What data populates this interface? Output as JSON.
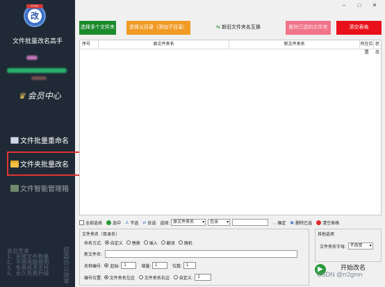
{
  "sidebar": {
    "logo_text": "改",
    "logo_tag": "FTPN",
    "app_title": "文件批量改名高手",
    "member_center": "会员中心",
    "nav": [
      {
        "label": "文件批量重命名"
      },
      {
        "label": "文件夹批量改名"
      },
      {
        "label": "文件智能管理箱"
      }
    ],
    "promo_lines": [
      "会员专享",
      "1、无限文件数量",
      "2、不限电脑使用",
      "3、免费技术支持",
      "4、永久免费升级"
    ],
    "vertical_text": "提高办公效率"
  },
  "window": {
    "minimize": "–",
    "maximize": "□",
    "close": "✕"
  },
  "toolbar": {
    "multi_folder": "选择多个文件夹",
    "parent_dir": "选择父目录（添加子目录）",
    "swap": "新旧文件夹名互换",
    "delete_selected": "删除已选的文件夹",
    "clear_list": "清空表格"
  },
  "table": {
    "headers": [
      "序号",
      "原文件夹名",
      "新文件夹名",
      "所在位置",
      "状态"
    ]
  },
  "selection": {
    "select_all": "全部选择",
    "select": "选中",
    "deselect": "不选",
    "invert": "反选",
    "choose_label": "选择:",
    "field_value": "原文件夹名",
    "match_value": "包含",
    "confirm": "确定",
    "delete_selected": "删除已选",
    "clear": "清空表格"
  },
  "rename_panel": {
    "legend": "文件夹名（目录名）",
    "mode_label": "命名方式:",
    "modes": [
      "自定义",
      "替换",
      "插入",
      "翻译",
      "随机"
    ],
    "new_name_label": "新文件名:",
    "numbering_label": "名称编号:",
    "start_label": "起始:",
    "start_value": "1",
    "step_label": "增量:",
    "step_value": "1",
    "digits_label": "位数:",
    "digits_value": "1",
    "position_label": "编号位置:",
    "positions": [
      "文件夹名左边",
      "文件夹名右边",
      "自定义:"
    ],
    "custom_value": "2"
  },
  "other_panel": {
    "legend": "其他选项",
    "case_label": "文件夹名字母:",
    "case_value": "不改变"
  },
  "start": {
    "label": "开始改名"
  },
  "watermark": "CSDN @rr2gmn"
}
